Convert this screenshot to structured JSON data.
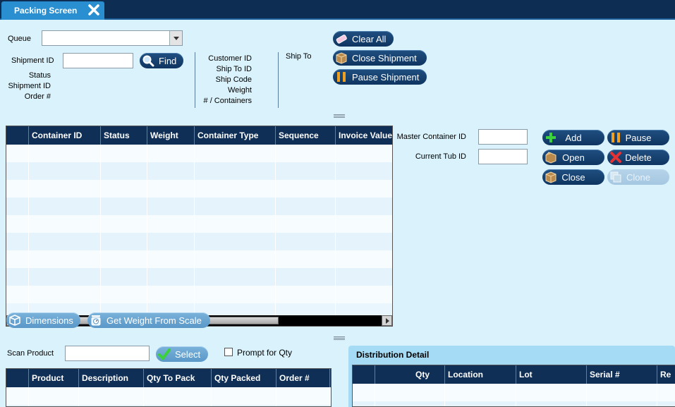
{
  "tab": {
    "title": "Packing Screen"
  },
  "form": {
    "queue_label": "Queue",
    "queue_value": "",
    "shipment_id_label": "Shipment ID",
    "shipment_id_value": "",
    "find_label": "Find",
    "status_label": "Status",
    "shipment_id2_label": "Shipment ID",
    "order_label": "Order #",
    "customer_id_label": "Customer ID",
    "ship_to_id_label": "Ship To ID",
    "ship_code_label": "Ship Code",
    "weight_label": "Weight",
    "containers_label": "# / Containers",
    "ship_to_label": "Ship To"
  },
  "actions": {
    "clear_all": "Clear All",
    "close_shipment": "Close Shipment",
    "pause_shipment": "Pause Shipment"
  },
  "containers_grid": {
    "columns": [
      "Container ID",
      "Status",
      "Weight",
      "Container Type",
      "Sequence",
      "Invoice Value"
    ],
    "rows": [
      [],
      [],
      [],
      [],
      [],
      [],
      [],
      [],
      []
    ]
  },
  "container_panel": {
    "master_label": "Master Container ID",
    "master_value": "",
    "tub_label": "Current Tub ID",
    "tub_value": "",
    "add": "Add",
    "pause": "Pause",
    "open": "Open",
    "delete": "Delete",
    "close": "Close",
    "clone": "Clone"
  },
  "tools": {
    "dimensions": "Dimensions",
    "get_weight": "Get Weight From Scale"
  },
  "scan": {
    "label": "Scan Product",
    "value": "",
    "select": "Select",
    "prompt_qty": "Prompt for Qty",
    "prompt_qty_checked": false
  },
  "product_grid": {
    "columns": [
      "Product",
      "Description",
      "Qty To Pack",
      "Qty Packed",
      "Order #"
    ],
    "rows": [
      []
    ]
  },
  "distribution": {
    "title": "Distribution Detail",
    "columns": [
      "Qty",
      "Location",
      "Lot",
      "Serial #",
      "Re"
    ],
    "rows": [
      []
    ]
  },
  "colors": {
    "background": "#d9f2fb",
    "header_dark": "#0f2f56",
    "tab_blue": "#2a8fd0",
    "button_dark": "#0f3561"
  }
}
